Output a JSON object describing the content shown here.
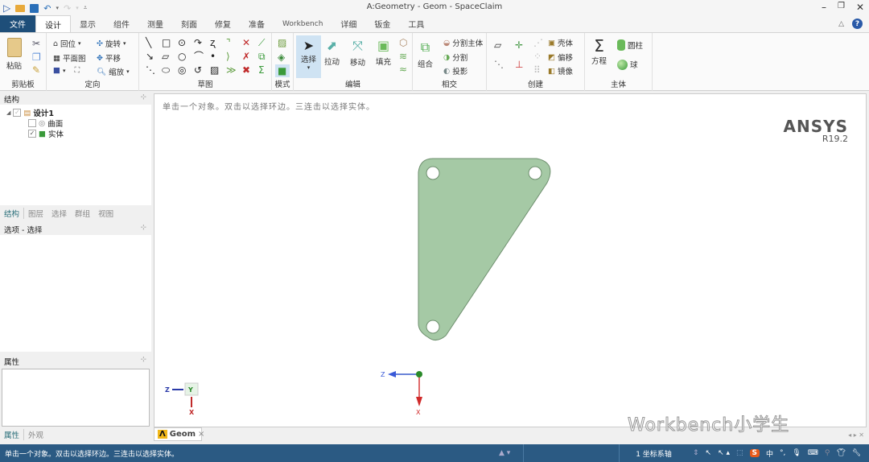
{
  "window": {
    "title": "A:Geometry - Geom - SpaceClaim",
    "controls": [
      "minimize",
      "restore",
      "close"
    ]
  },
  "quick_access": [
    "play-icon",
    "open-folder-icon",
    "save-icon",
    "undo-icon",
    "redo-icon",
    "customize-icon"
  ],
  "tabs": [
    {
      "label": "文件",
      "type": "file"
    },
    {
      "label": "设计",
      "active": true
    },
    {
      "label": "显示"
    },
    {
      "label": "组件"
    },
    {
      "label": "测量"
    },
    {
      "label": "刻面"
    },
    {
      "label": "修复"
    },
    {
      "label": "准备"
    },
    {
      "label": "Workbench"
    },
    {
      "label": "详细"
    },
    {
      "label": "钣金"
    },
    {
      "label": "工具"
    }
  ],
  "ribbon": {
    "clipboard": {
      "label": "剪贴板",
      "paste": "粘贴"
    },
    "orient": {
      "label": "定向",
      "home": "回位",
      "rotate": "旋转",
      "plan_view": "平面图",
      "pan": "平移",
      "zoom": "缩放"
    },
    "sketch": {
      "label": "草图"
    },
    "mode": {
      "label": "模式"
    },
    "edit": {
      "label": "编辑",
      "select": "选择",
      "pull": "拉动",
      "move": "移动",
      "fill": "填充"
    },
    "intersect": {
      "label": "相交",
      "combine": "组合",
      "split_body": "分割主体",
      "split": "分割",
      "project": "投影"
    },
    "create": {
      "label": "创建",
      "shell": "壳体",
      "offset": "偏移",
      "mirror": "镜像"
    },
    "body": {
      "label": "主体",
      "equation": "方程",
      "cylinder": "圆柱",
      "sphere": "球"
    }
  },
  "structure_panel": {
    "title": "结构",
    "tree": [
      {
        "label": "设计1",
        "checked": true,
        "bold": true
      },
      {
        "label": "曲面",
        "checked": false
      },
      {
        "label": "实体",
        "checked": true
      }
    ],
    "tabs": [
      "结构",
      "图层",
      "选择",
      "群组",
      "视图"
    ]
  },
  "options_panel": {
    "title": "选项 - 选择"
  },
  "properties_panel": {
    "title": "属性",
    "tabs": [
      "属性",
      "外观"
    ]
  },
  "viewport": {
    "hint": "单击一个对象。双击以选择环边。三连击以选择实体。",
    "brand": "ANSYS",
    "version": "R19.2",
    "part_color": "#a5c9a5",
    "triad_small": {
      "z": "Z",
      "y": "Y",
      "x": "X"
    },
    "triad_center": {
      "z": "Z",
      "x": "X"
    }
  },
  "doc_tab": {
    "label": "Geom"
  },
  "status": {
    "message": "单击一个对象。双击以选择环边。三连击以选择实体。",
    "coord_system": "1 坐标系轴",
    "ime": "中"
  },
  "watermark": "Workbench小学生"
}
